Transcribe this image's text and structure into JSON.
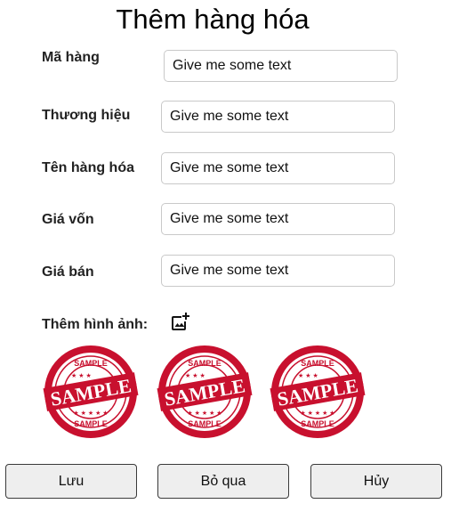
{
  "title": "Thêm hàng hóa",
  "fields": [
    {
      "label": "Mã hàng",
      "value": "Give me some text"
    },
    {
      "label": "Thương hiệu",
      "value": "Give me some text"
    },
    {
      "label": "Tên hàng hóa",
      "value": "Give me some text"
    },
    {
      "label": "Giá vốn",
      "value": "Give me some text"
    },
    {
      "label": "Giá bán",
      "value": "Give me some text"
    }
  ],
  "images": {
    "label": "Thêm hình ảnh:",
    "icon": "add-photo-icon",
    "samples": [
      {
        "text": "SAMPLE"
      },
      {
        "text": "SAMPLE"
      },
      {
        "text": "SAMPLE"
      }
    ]
  },
  "buttons": {
    "save": "Lưu",
    "skip": "Bỏ qua",
    "cancel": "Hủy"
  },
  "colors": {
    "stamp_red": "#c8102e",
    "button_bg": "#eeeeee",
    "field_border": "#c9c9c9"
  }
}
